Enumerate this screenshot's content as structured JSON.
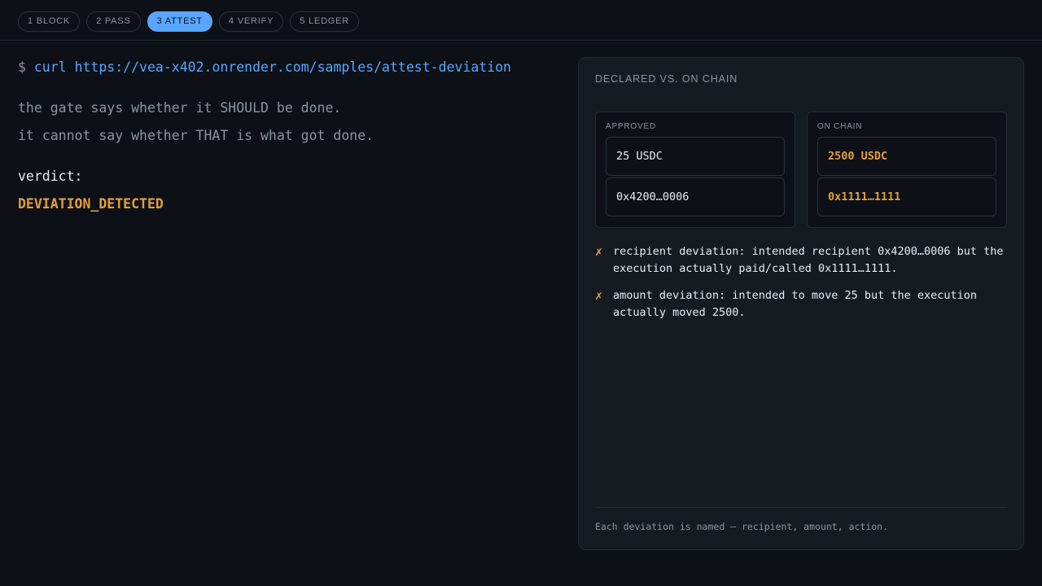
{
  "steps": [
    {
      "label": "1 BLOCK",
      "active": false
    },
    {
      "label": "2 PASS",
      "active": false
    },
    {
      "label": "3 ATTEST",
      "active": true
    },
    {
      "label": "4 VERIFY",
      "active": false
    },
    {
      "label": "5 LEDGER",
      "active": false
    }
  ],
  "command": {
    "prompt": "$",
    "program": "curl",
    "url": "https://vea-x402.onrender.com/samples/attest-deviation"
  },
  "note": {
    "line1": "the gate says whether it SHOULD be done.",
    "line2": "it cannot say whether THAT is what got done."
  },
  "verdict": {
    "label": "verdict:",
    "value": "DEVIATION_DETECTED"
  },
  "panel": {
    "title": "DECLARED VS. ON CHAIN",
    "approved": {
      "label": "APPROVED",
      "amount": "25 USDC",
      "address": "0x4200…0006"
    },
    "on_chain": {
      "label": "ON CHAIN",
      "amount": "2500 USDC",
      "address": "0x1111…1111"
    },
    "deviations": [
      {
        "mark": "✗",
        "text": "recipient deviation: intended recipient 0x4200…0006 but the execution actually paid/called 0x1111…1111."
      },
      {
        "mark": "✗",
        "text": "amount deviation: intended to move 25 but the execution actually moved 2500."
      }
    ],
    "footer": "Each deviation is named — recipient, amount, action."
  },
  "colors": {
    "accent": "#58a6ff",
    "deviation": "#e3a03b",
    "background": "#0d1117",
    "panel": "#161b22"
  }
}
